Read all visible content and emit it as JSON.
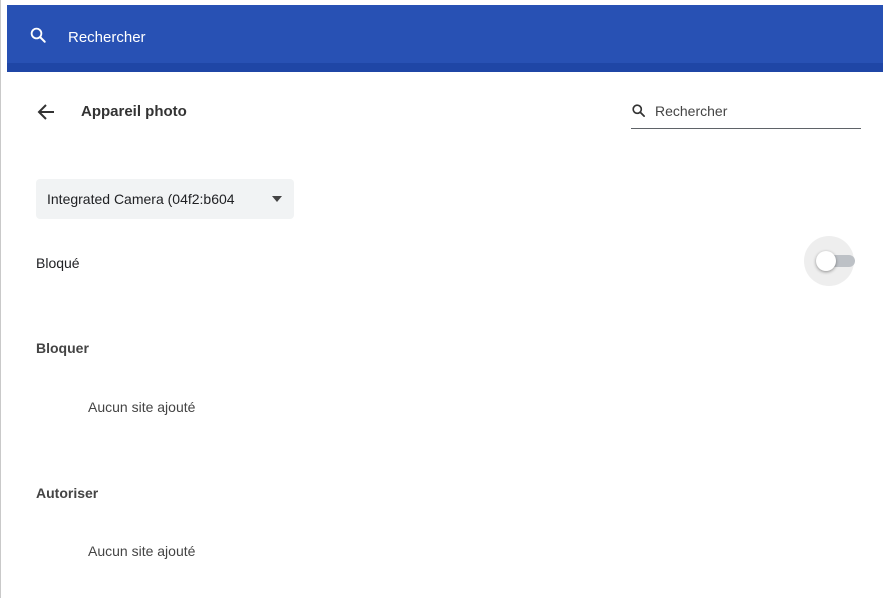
{
  "topbar": {
    "search_label": "Rechercher",
    "background_color": "#2851b4",
    "icon": "search-icon"
  },
  "header": {
    "title": "Appareil photo",
    "back_icon": "back-arrow-icon",
    "search": {
      "placeholder": "Rechercher",
      "value": "",
      "icon": "search-icon"
    }
  },
  "device_select": {
    "selected": "Integrated Camera (04f2:b604",
    "icon": "dropdown-caret-icon"
  },
  "blocked_setting": {
    "label": "Bloqué",
    "enabled": false
  },
  "sections": {
    "block": {
      "title": "Bloquer",
      "empty_text": "Aucun site ajouté"
    },
    "allow": {
      "title": "Autoriser",
      "empty_text": "Aucun site ajouté"
    }
  }
}
